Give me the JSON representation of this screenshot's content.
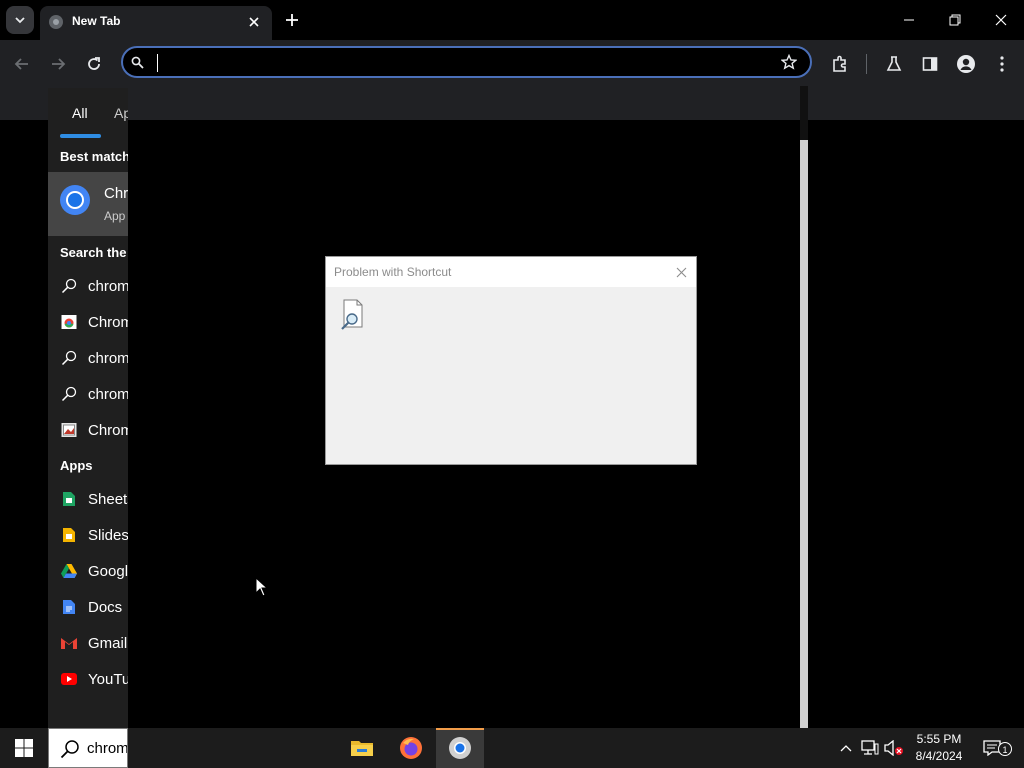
{
  "browser": {
    "tab": {
      "title": "New Tab"
    },
    "omnibox": {
      "value": "",
      "placeholder": ""
    }
  },
  "start_search": {
    "filters": [
      {
        "label": "All",
        "active": true
      },
      {
        "label": "Ap"
      }
    ],
    "best_match": {
      "heading": "Best match",
      "title": "Chr",
      "subtitle": "App",
      "icon": "chrome-icon"
    },
    "search_web": {
      "heading": "Search the w",
      "items": [
        {
          "label": "chrom",
          "icon": "search-icon"
        },
        {
          "label": "Chrom",
          "icon": "chrome-page-icon"
        },
        {
          "label": "chrom",
          "icon": "search-icon"
        },
        {
          "label": "chrom",
          "icon": "search-icon"
        },
        {
          "label": "Chrom",
          "icon": "image-icon"
        }
      ]
    },
    "apps": {
      "heading": "Apps",
      "items": [
        {
          "label": "Sheets",
          "icon": "sheets-icon",
          "color": "#1fa463"
        },
        {
          "label": "Slides",
          "icon": "slides-icon",
          "color": "#f4b400"
        },
        {
          "label": "Googl",
          "icon": "drive-icon",
          "color": "#4285f4"
        },
        {
          "label": "Docs",
          "icon": "docs-icon",
          "color": "#4285f4"
        },
        {
          "label": "Gmail",
          "icon": "gmail-icon",
          "color": "#ea4335"
        },
        {
          "label": "YouTu",
          "icon": "youtube-icon",
          "color": "#ff0000"
        }
      ]
    }
  },
  "dialog": {
    "title": "Problem with Shortcut",
    "icon": "document-search-icon"
  },
  "taskbar": {
    "search_text": "chrom",
    "apps": [
      "file-explorer-icon",
      "firefox-icon",
      "chrome-icon"
    ],
    "clock": {
      "time": "5:55 PM",
      "date": "8/4/2024"
    },
    "notification_count": "1"
  },
  "colors": {
    "accent": "#2f8de4",
    "omnibox_border": "#4a6fb8",
    "taskbar_active": "#f29d4a"
  }
}
